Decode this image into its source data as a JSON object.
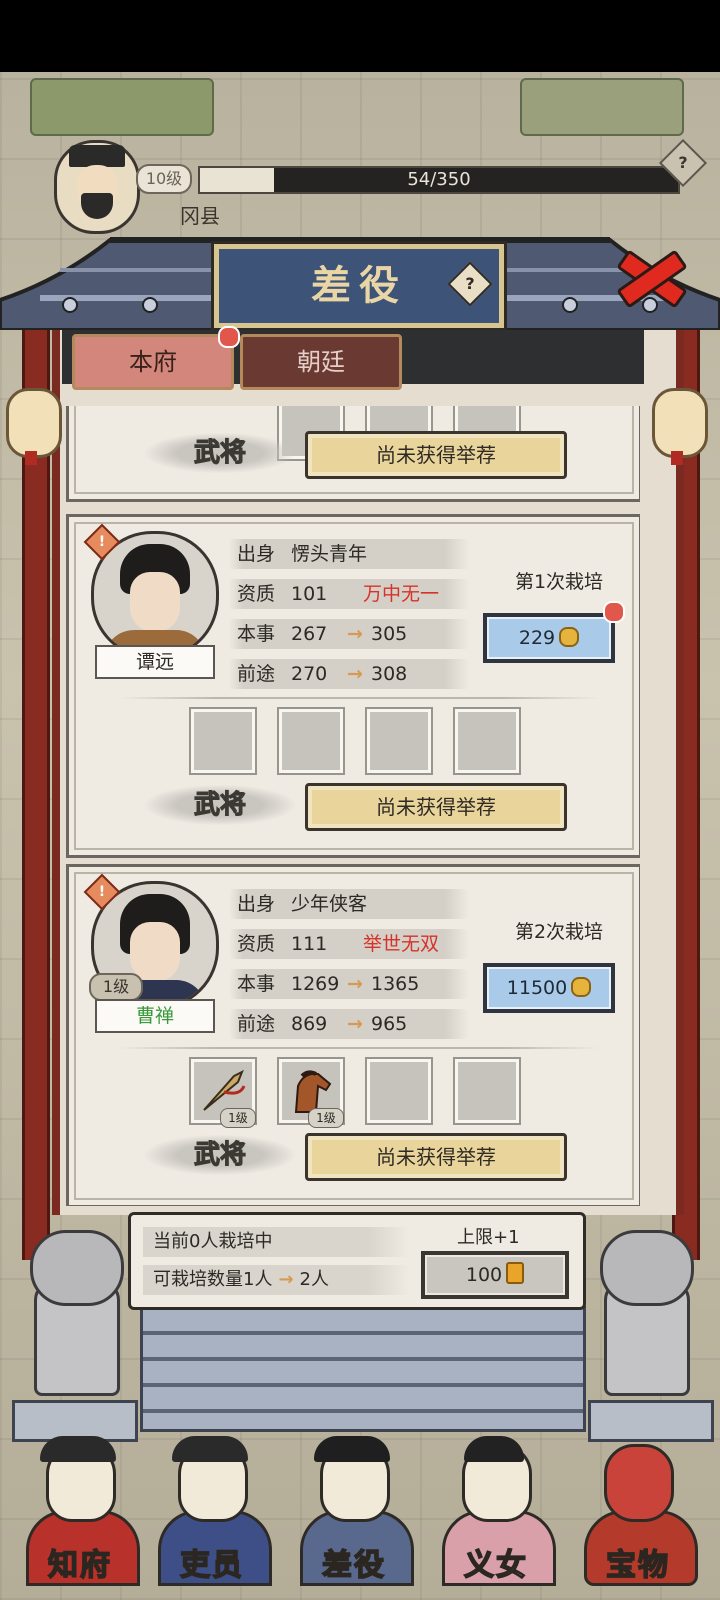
{
  "player": {
    "level": "10级",
    "xp_text": "54/350",
    "xp_fraction": 0.154,
    "name": "冈县"
  },
  "window": {
    "title": "差役"
  },
  "tabs": [
    {
      "label": "本府"
    },
    {
      "label": "朝廷"
    }
  ],
  "cards": [
    {
      "role": "武将",
      "recommend": "尚未获得举荐"
    },
    {
      "name": "谭远",
      "stats": {
        "origin_k": "出身",
        "origin": "愣头青年",
        "apt_k": "资质",
        "apt": "101",
        "apt_rank": "万中无一",
        "skill_k": "本事",
        "skill": "267",
        "skill_to": "305",
        "future_k": "前途",
        "future": "270",
        "future_to": "308"
      },
      "cultivate_label": "第1次栽培",
      "cost": "229",
      "role": "武将",
      "recommend": "尚未获得举荐"
    },
    {
      "name": "曹禅",
      "level": "1级",
      "stats": {
        "origin_k": "出身",
        "origin": "少年侠客",
        "apt_k": "资质",
        "apt": "111",
        "apt_rank": "举世无双",
        "skill_k": "本事",
        "skill": "1269",
        "skill_to": "1365",
        "future_k": "前途",
        "future": "869",
        "future_to": "965"
      },
      "cultivate_label": "第2次栽培",
      "cost": "11500",
      "items": [
        {
          "icon": "dart-icon",
          "level": "1级"
        },
        {
          "icon": "horse-icon",
          "level": "1级"
        }
      ],
      "role": "武将",
      "recommend": "尚未获得举荐"
    }
  ],
  "footer": {
    "current": "当前0人栽培中",
    "capacity": "可栽培数量1人",
    "capacity_to": "2人",
    "limit_label": "上限+1",
    "limit_cost": "100"
  },
  "nav": [
    {
      "label": "知府"
    },
    {
      "label": "吏员"
    },
    {
      "label": "差役"
    },
    {
      "label": "义女"
    },
    {
      "label": "宝物"
    }
  ],
  "colors": {
    "accent_red": "#d6322a",
    "button_blue": "#a9cbe9",
    "button_gold": "#e9d59b",
    "frame_red": "#8a2b22"
  }
}
